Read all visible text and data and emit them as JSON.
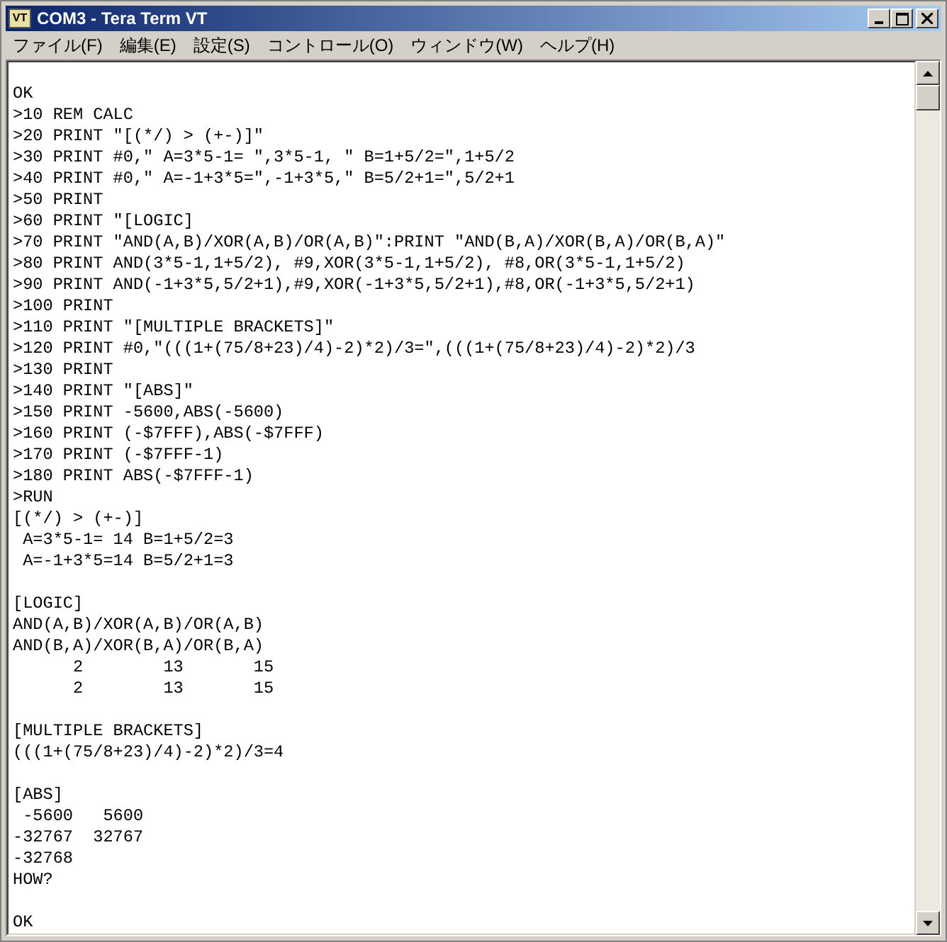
{
  "window": {
    "title": "COM3 - Tera Term VT",
    "icon_text": "VT"
  },
  "menu": [
    "ファイル(F)",
    "編集(E)",
    "設定(S)",
    "コントロール(O)",
    "ウィンドウ(W)",
    "ヘルプ(H)"
  ],
  "terminal": {
    "blocks": [
      [
        "OK",
        ">10 REM CALC",
        ">20 PRINT \"[(*/) > (+-)]\"",
        ">30 PRINT #0,\" A=3*5-1= \",3*5-1, \" B=1+5/2=\",1+5/2",
        ">40 PRINT #0,\" A=-1+3*5=\",-1+3*5,\" B=5/2+1=\",5/2+1",
        ">50 PRINT",
        ">60 PRINT \"[LOGIC]",
        ">70 PRINT \"AND(A,B)/XOR(A,B)/OR(A,B)\":PRINT \"AND(B,A)/XOR(B,A)/OR(B,A)\"",
        ">80 PRINT AND(3*5-1,1+5/2), #9,XOR(3*5-1,1+5/2), #8,OR(3*5-1,1+5/2)",
        ">90 PRINT AND(-1+3*5,5/2+1),#9,XOR(-1+3*5,5/2+1),#8,OR(-1+3*5,5/2+1)",
        ">100 PRINT",
        ">110 PRINT \"[MULTIPLE BRACKETS]\"",
        ">120 PRINT #0,\"(((1+(75/8+23)/4)-2)*2)/3=\",(((1+(75/8+23)/4)-2)*2)/3",
        ">130 PRINT",
        ">140 PRINT \"[ABS]\"",
        ">150 PRINT -5600,ABS(-5600)",
        ">160 PRINT (-$7FFF),ABS(-$7FFF)",
        ">170 PRINT (-$7FFF-1)",
        ">180 PRINT ABS(-$7FFF-1)",
        ">RUN",
        "[(*/) > (+-)]",
        " A=3*5-1= 14 B=1+5/2=3",
        " A=-1+3*5=14 B=5/2+1=3"
      ],
      [
        "[LOGIC]",
        "AND(A,B)/XOR(A,B)/OR(A,B)",
        "AND(B,A)/XOR(B,A)/OR(B,A)",
        "      2        13       15",
        "      2        13       15"
      ],
      [
        "[MULTIPLE BRACKETS]",
        "(((1+(75/8+23)/4)-2)*2)/3=4"
      ],
      [
        "[ABS]",
        " -5600   5600",
        "-32767  32767",
        "-32768",
        "HOW?"
      ],
      [
        "OK"
      ]
    ]
  }
}
